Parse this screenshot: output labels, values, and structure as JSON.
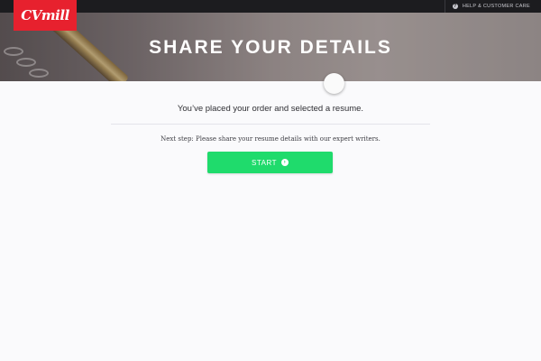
{
  "brand": {
    "logo_text": "CVmill",
    "logo_color": "#e7212e"
  },
  "topbar": {
    "help_label": "HELP & CUSTOMER CARE",
    "help_icon": "question-circle-icon"
  },
  "hero": {
    "title": "SHARE YOUR DETAILS"
  },
  "main": {
    "confirmation": "You’ve placed your order and selected a resume.",
    "next_step": "Next step: Please share your resume details with our expert writers.",
    "start_label": "START",
    "start_icon": "arrow-right-circle-icon",
    "start_color": "#1fdb6c"
  }
}
